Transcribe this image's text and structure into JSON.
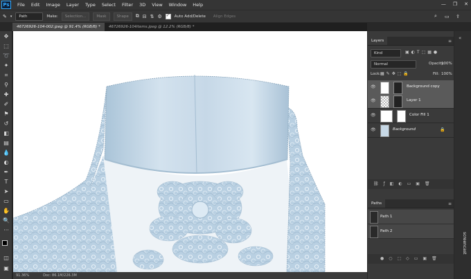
{
  "app": {
    "logo": "Ps"
  },
  "menu": [
    "File",
    "Edit",
    "Image",
    "Layer",
    "Type",
    "Select",
    "Filter",
    "3D",
    "View",
    "Window",
    "Help"
  ],
  "options": {
    "mode": "Path",
    "make_label": "Make:",
    "selection_btn": "Selection...",
    "mask_btn": "Mask",
    "shape_btn": "Shape",
    "auto_add_delete": "Auto Add/Delete",
    "align_edges": "Align Edges"
  },
  "tabs": [
    {
      "label": "46726926-104-002.jpeg @ 91.4% (RGB/8) *",
      "active": true
    },
    {
      "label": "46726926-104items.jpeg @ 12.2% (RGB/8) *",
      "active": false
    }
  ],
  "status": {
    "zoom": "91.36%",
    "doc": "Doc: 86.1M/226.3M"
  },
  "layers_panel": {
    "title": "Layers",
    "filter": "Kind",
    "blend_mode": "Normal",
    "opacity_label": "Opacity:",
    "opacity": "100%",
    "lock_label": "Lock:",
    "fill_label": "Fill:",
    "fill": "100%",
    "layers": [
      {
        "name": "Background copy",
        "selected": true
      },
      {
        "name": "Layer 1",
        "selected": true
      },
      {
        "name": "Color Fill 1",
        "selected": false
      },
      {
        "name": "Background",
        "selected": false
      }
    ]
  },
  "paths_panel": {
    "title": "Paths",
    "paths": [
      {
        "name": "Path 1"
      },
      {
        "name": "Path 2"
      }
    ]
  },
  "watermark": "screencast",
  "colors": {
    "accent": "#31a8ff",
    "canvas": "#ffffff",
    "panel": "#3a3a3a"
  }
}
